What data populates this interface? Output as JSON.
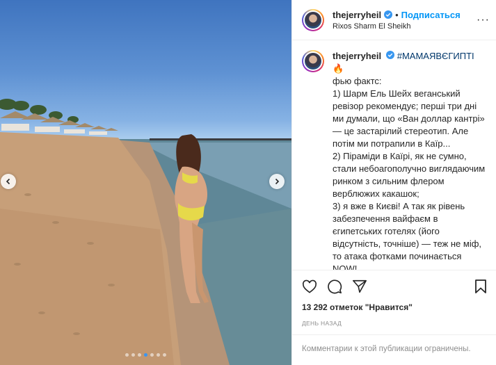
{
  "post": {
    "username": "thejerryheil",
    "follow_label": "Подписаться",
    "separator": "•",
    "location": "Rixos Sharm El Sheikh",
    "more_label": "···"
  },
  "caption": {
    "username": "thejerryheil",
    "hashtag": "#МАМАЯВЄГИПТІ",
    "text": "фью фактс:\n1) Шарм Ель Шейх веганський ревізор рекомендує; перші три дні ми думали, що «Ван доллар кантрі» — це застарілий стереотип. Але потім ми потрапили в Каїр...\n2) Піраміди в Каїрі, як не сумно, стали небоагополучно виглядаючим ринком з сильним флером верблюжих какашок;\n3) я вже в Києві! А так як рівень забезпечення вайфаєм в єгипетських готелях (його відсутність, точніше) — теж не міф, то атака фотками починається NOW!\n\nЗ вас по коментарю про ваш досвід з Єгиптом🔥 що сподобалося, що важливо побачити (окрім очевидного)"
  },
  "stats": {
    "likes": "13 292 отметок \"Нравится\"",
    "time_ago": "День назад"
  },
  "footer": {
    "comments_limited": "Комментарии к этой публикации ограничены."
  },
  "carousel": {
    "count": 7,
    "active_index": 3
  },
  "colors": {
    "accent": "#0095f6",
    "active_dot": "#3b95f0",
    "muted": "#8e8e8e"
  },
  "icons": [
    "chevron-left-icon",
    "chevron-right-icon",
    "verified-icon",
    "more-icon",
    "heart-icon",
    "comment-icon",
    "share-icon",
    "bookmark-icon"
  ]
}
